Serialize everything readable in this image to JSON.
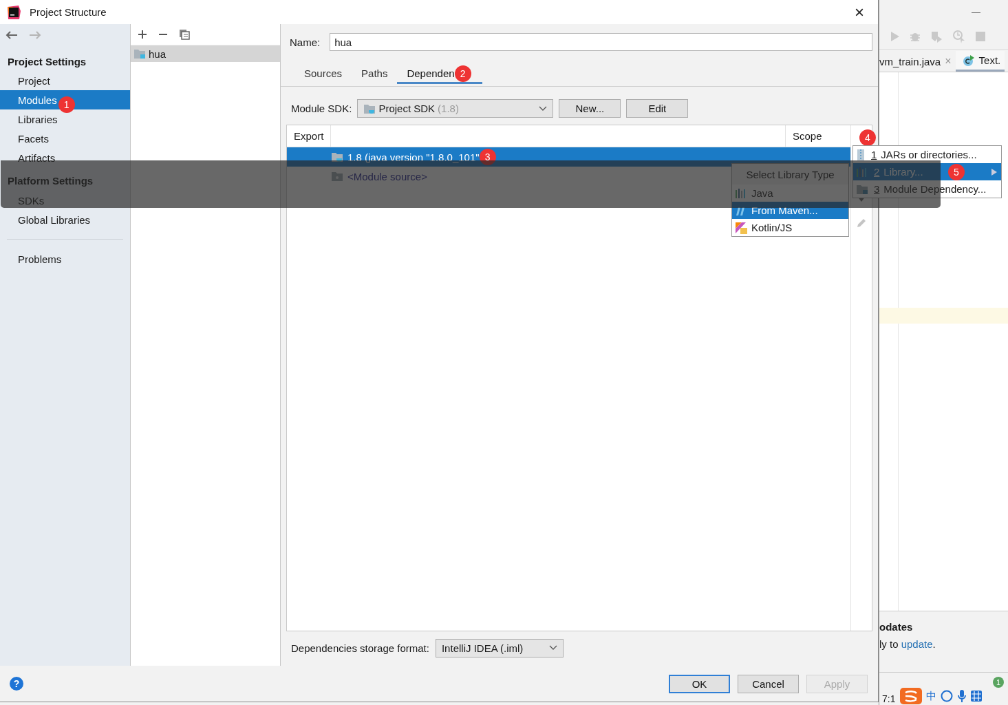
{
  "window": {
    "title": "Project Structure",
    "close": "×"
  },
  "sidebar": {
    "groups": [
      {
        "heading": "Project Settings",
        "items": [
          {
            "label": "Project",
            "selected": false
          },
          {
            "label": "Modules",
            "selected": true
          },
          {
            "label": "Libraries",
            "selected": false
          },
          {
            "label": "Facets",
            "selected": false
          },
          {
            "label": "Artifacts",
            "selected": false
          }
        ]
      },
      {
        "heading": "Platform Settings",
        "items": [
          {
            "label": "SDKs",
            "selected": false
          },
          {
            "label": "Global Libraries",
            "selected": false
          }
        ]
      }
    ],
    "extra_items": [
      {
        "label": "Problems",
        "selected": false
      }
    ]
  },
  "modules": {
    "items": [
      {
        "name": "hua",
        "selected": true
      }
    ]
  },
  "name_field": {
    "label": "Name:",
    "value": "hua"
  },
  "tabs": [
    {
      "label": "Sources",
      "selected": false
    },
    {
      "label": "Paths",
      "selected": false
    },
    {
      "label": "Dependen",
      "selected": true
    }
  ],
  "module_sdk": {
    "label": "Module SDK:",
    "value": "Project SDK",
    "version": "(1.8)",
    "buttons": [
      "New...",
      "Edit"
    ]
  },
  "table": {
    "columns": [
      "Export",
      "Scope"
    ],
    "rows": [
      {
        "name": "1.8 (java version \"1.8.0_101\"",
        "kind": "sdk",
        "selected": true
      },
      {
        "name": "<Module source>",
        "kind": "source",
        "selected": false
      }
    ]
  },
  "add_menu": {
    "items": [
      {
        "number": "1",
        "label": "JARs or directories...",
        "kind": "jar",
        "selected": false,
        "submenu": false
      },
      {
        "number": "2",
        "label": "Library...",
        "kind": "library",
        "selected": true,
        "submenu": true
      },
      {
        "number": "3",
        "label": "Module Dependency...",
        "kind": "module",
        "selected": false,
        "submenu": false
      }
    ]
  },
  "library_type_menu": {
    "title": "Select Library Type",
    "items": [
      {
        "label": "Java",
        "kind": "java",
        "selected": false
      },
      {
        "label": "From Maven...",
        "kind": "maven",
        "selected": true
      },
      {
        "label": "Kotlin/JS",
        "kind": "kotlin",
        "selected": false
      }
    ]
  },
  "storage_format": {
    "label": "Dependencies storage format:",
    "value": "IntelliJ IDEA (.iml)"
  },
  "help": "?",
  "buttons": [
    {
      "label": "OK",
      "default": true,
      "disabled": false
    },
    {
      "label": "Cancel",
      "default": false,
      "disabled": false
    },
    {
      "label": "Apply",
      "default": false,
      "disabled": true
    }
  ],
  "markers": [
    "1",
    "2",
    "3",
    "4",
    "5"
  ],
  "background_ide": {
    "minimize": "—",
    "tabs": [
      {
        "label": "vm_train.java",
        "close": "×",
        "selected": false
      },
      {
        "label": "Text.",
        "selected": true
      }
    ],
    "notification": {
      "title": "odates",
      "before": "ly to ",
      "link": "update",
      "after": "."
    },
    "position": "7:1",
    "event_count": "1",
    "input_mode": "中"
  }
}
